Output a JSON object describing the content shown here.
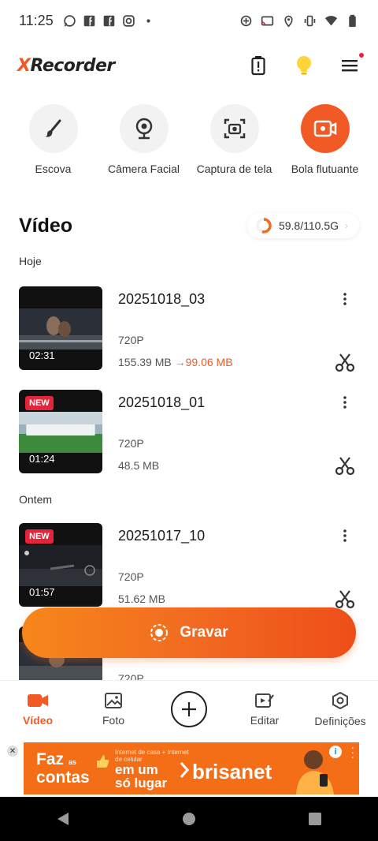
{
  "status_bar": {
    "time": "11:25",
    "left_icons": [
      "whatsapp-icon",
      "facebook-icon",
      "facebook-icon",
      "instagram-icon",
      "dot-icon"
    ],
    "right_icons": [
      "data-saver-icon",
      "cast-icon",
      "location-icon",
      "vibrate-icon",
      "wifi-icon",
      "battery-icon"
    ]
  },
  "header": {
    "logo_x": "X",
    "logo_rest": "Recorder",
    "icons": [
      "battery-alert-icon",
      "lightbulb-icon",
      "menu-icon"
    ]
  },
  "tools": [
    {
      "label": "Escova",
      "icon": "brush-icon"
    },
    {
      "label": "Câmera Facial",
      "icon": "webcam-icon"
    },
    {
      "label": "Captura de tela",
      "icon": "screenshot-icon"
    },
    {
      "label": "Bola flutuante",
      "icon": "floating-ball-icon"
    }
  ],
  "section": {
    "title": "Vídeo",
    "storage": "59.8/110.5G",
    "storage_used_fraction": 0.54
  },
  "groups": {
    "today": "Hoje",
    "yesterday": "Ontem"
  },
  "videos": [
    {
      "title": "20251018_03",
      "duration": "02:31",
      "resolution": "720P",
      "size": "155.39 MB",
      "arrow": "→",
      "size_compressed": "99.06 MB",
      "new": ""
    },
    {
      "title": "20251018_01",
      "duration": "01:24",
      "resolution": "720P",
      "size": "48.5 MB",
      "new": "NEW"
    },
    {
      "title": "20251017_10",
      "duration": "01:57",
      "resolution": "720P",
      "size": "51.62 MB",
      "new": "NEW"
    },
    {
      "resolution": "720P"
    }
  ],
  "record": {
    "label": "Gravar"
  },
  "bottom_nav": [
    {
      "label": "Vídeo",
      "icon": "video-camera-icon"
    },
    {
      "label": "Foto",
      "icon": "photo-icon"
    },
    {
      "label": "",
      "icon": "add-icon"
    },
    {
      "label": "Editar",
      "icon": "edit-video-icon"
    },
    {
      "label": "Definições",
      "icon": "settings-icon"
    }
  ],
  "ad": {
    "close": "✕",
    "faz": "Faz",
    "as": "as",
    "contas": "contas",
    "small_text": "Internet de casa + Internet de celular",
    "em_um": "em um",
    "so_lugar": "só lugar",
    "brand": "brisanet",
    "info": "i"
  },
  "colors": {
    "accent": "#f15a24",
    "new_badge": "#e5243b"
  }
}
